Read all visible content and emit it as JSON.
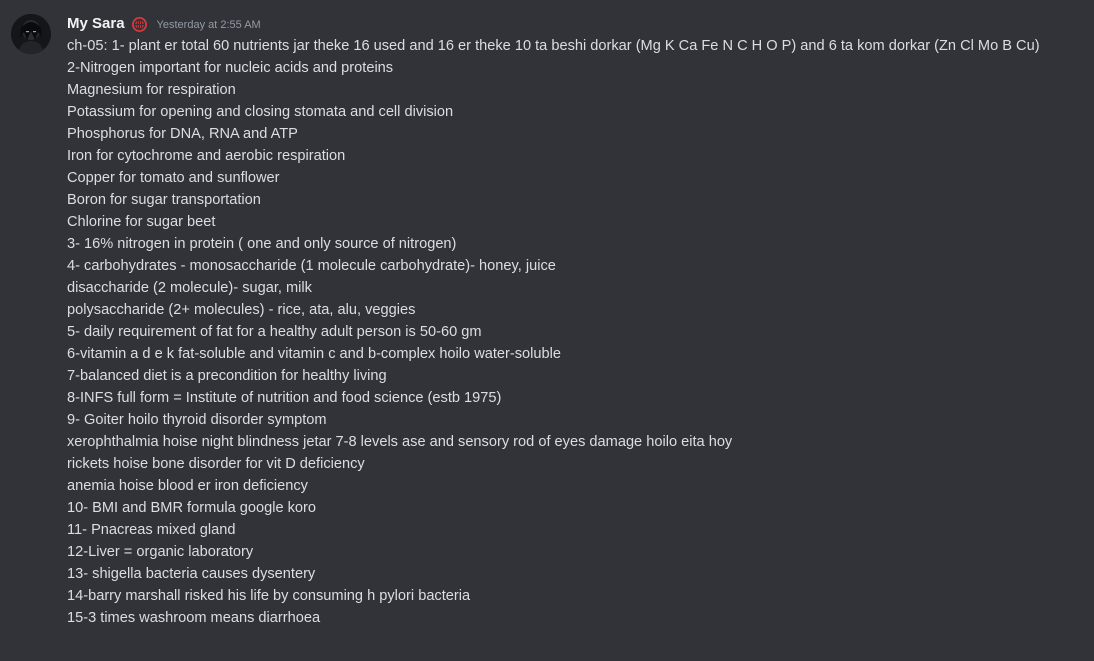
{
  "message": {
    "author": {
      "name": "My Sara",
      "avatar_icon": "avatar-image",
      "role_icon": "globe-badge-icon",
      "role_color": "#da373c"
    },
    "timestamp": "Yesterday at 2:55 AM",
    "lines": [
      "ch-05: 1- plant er total 60 nutrients jar theke 16 used and 16 er theke 10 ta beshi dorkar (Mg K Ca Fe N C H O P) and 6 ta kom dorkar (Zn Cl Mo B Cu)",
      "2-Nitrogen important for nucleic acids and proteins",
      "Magnesium for respiration",
      "Potassium for opening and closing stomata and cell division",
      "Phosphorus for DNA, RNA and ATP",
      "Iron for cytochrome and aerobic respiration",
      "Copper for tomato and sunflower",
      "Boron for sugar transportation",
      "Chlorine for sugar beet",
      "3- 16% nitrogen in protein ( one and only source of nitrogen)",
      "4- carbohydrates - monosaccharide (1 molecule carbohydrate)- honey, juice",
      "disaccharide (2 molecule)- sugar, milk",
      "polysaccharide (2+ molecules) - rice, ata, alu, veggies",
      "5- daily requirement of fat for a healthy adult person is 50-60 gm",
      "6-vitamin a d e k fat-soluble and vitamin c and b-complex hoilo water-soluble",
      "7-balanced diet is a precondition for healthy living",
      "8-INFS full form = Institute of nutrition and food science (estb 1975)",
      "9- Goiter hoilo thyroid disorder symptom",
      "xerophthalmia hoise night blindness jetar 7-8 levels ase and sensory rod of eyes damage hoilo eita hoy",
      "rickets hoise bone disorder for vit D deficiency",
      "anemia hoise blood er iron deficiency",
      "10- BMI and BMR formula google koro",
      "11- Pnacreas mixed gland",
      "12-Liver = organic laboratory",
      "13- shigella bacteria causes dysentery",
      "14-barry marshall risked his life by consuming h pylori bacteria",
      "15-3 times washroom means diarrhoea"
    ]
  },
  "colors": {
    "background": "#313338",
    "username": "#f2f3f5",
    "timestamp": "#949ba4",
    "text": "#dbdee1"
  }
}
